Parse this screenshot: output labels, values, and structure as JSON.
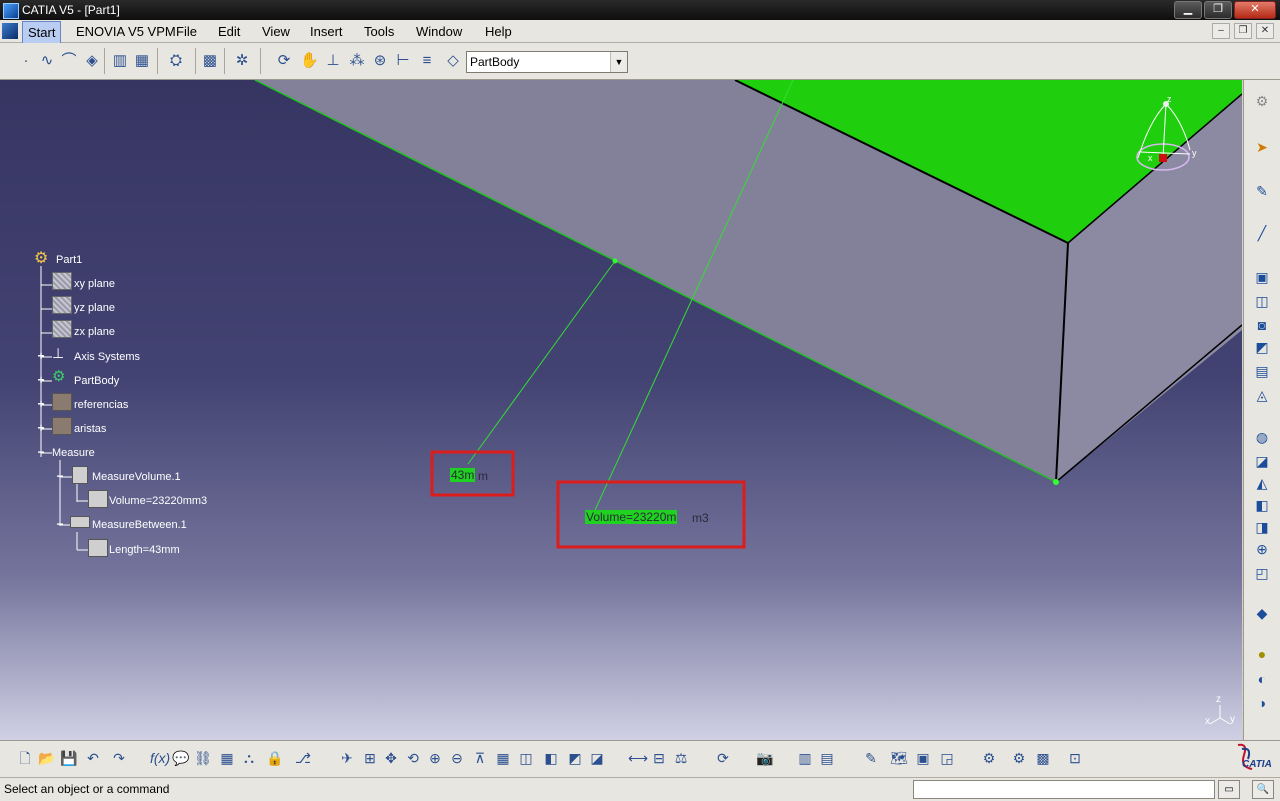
{
  "window": {
    "title": "CATIA V5 - [Part1]",
    "minimize": "▁",
    "maximize": "❐",
    "close": "✕"
  },
  "mdi": {
    "minimize": "–",
    "restore": "❐",
    "close": "✕"
  },
  "menu": {
    "items": [
      "Start",
      "ENOVIA V5 VPM",
      "File",
      "Edit",
      "View",
      "Insert",
      "Tools",
      "Window",
      "Help"
    ]
  },
  "toolbar": {
    "body_select": "PartBody",
    "dropdown_arrow": "▼"
  },
  "tree": {
    "root": "Part1",
    "nodes": [
      "xy plane",
      "yz plane",
      "zx plane",
      "Axis Systems",
      "PartBody",
      "referencias",
      "aristas",
      "Measure",
      "MeasureVolume.1",
      "Volume=23220mm3",
      "MeasureBetween.1",
      "Length=43mm"
    ]
  },
  "viewport": {
    "length_label_green": "43m",
    "length_label_rest": "m",
    "volume_label_green": "Volume=23220m",
    "volume_label_rest": "m3",
    "highlight_color": "#dd1c1c",
    "face_color": "#1fcf0e",
    "compass_axes": {
      "x": "x",
      "y": "y",
      "z": "z"
    },
    "mini_axes": {
      "x": "x",
      "y": "y",
      "z": "z"
    }
  },
  "status": {
    "prompt": "Select an object or a command"
  },
  "brand": {
    "logo_text": "CATIA"
  }
}
